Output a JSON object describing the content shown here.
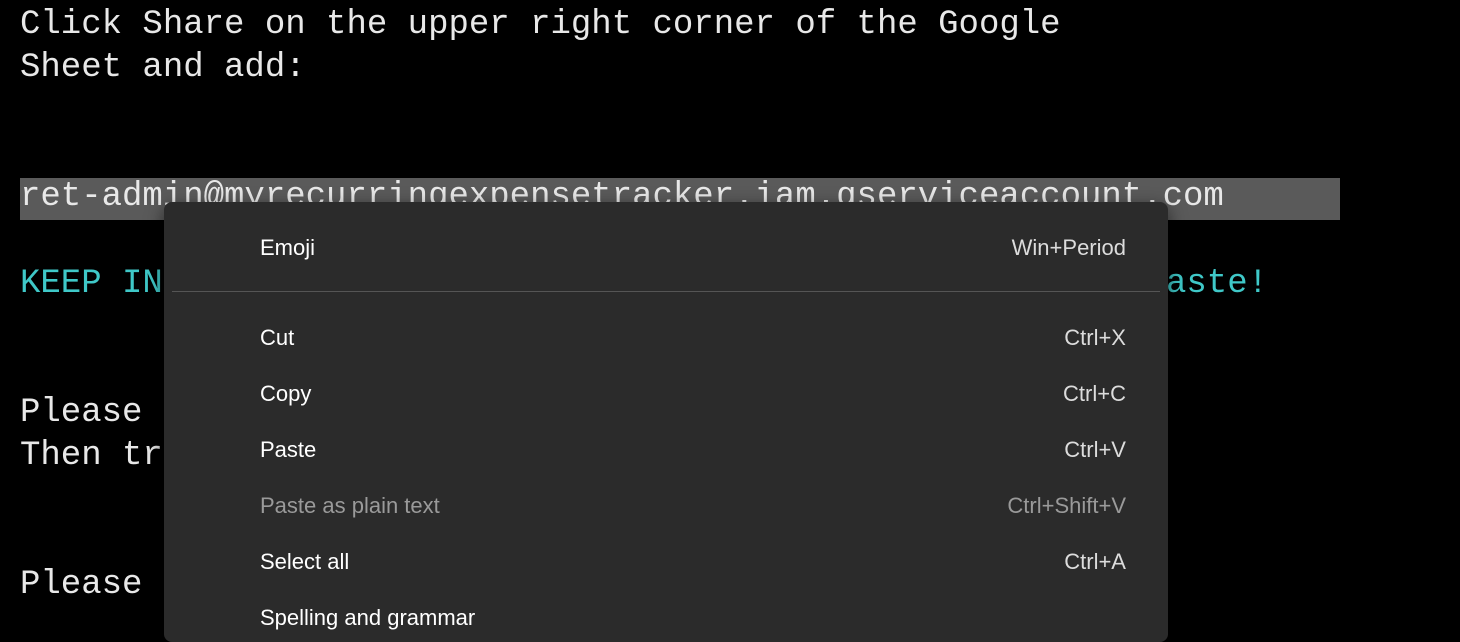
{
  "terminal": {
    "lines": [
      "Click Share on the upper right corner of the Google",
      "Sheet and add:",
      "ret-admin@myrecurringexpensetracker.iam.gserviceaccount.com",
      "KEEP IN",
      "aste!",
      "Please",
      "Then tr",
      "Please"
    ],
    "text_color": "#e8e8e8",
    "accent_color": "#3fc8c8",
    "selection_color": "#5a5a5a"
  },
  "context_menu": {
    "items": [
      {
        "label": "Emoji",
        "shortcut": "Win+Period"
      },
      {
        "label": "Cut",
        "shortcut": "Ctrl+X"
      },
      {
        "label": "Copy",
        "shortcut": "Ctrl+C"
      },
      {
        "label": "Paste",
        "shortcut": "Ctrl+V"
      },
      {
        "label": "Paste as plain text",
        "shortcut": "Ctrl+Shift+V"
      },
      {
        "label": "Select all",
        "shortcut": "Ctrl+A"
      },
      {
        "label": "Spelling and grammar",
        "shortcut": ""
      }
    ],
    "background": "#2b2b2b"
  }
}
